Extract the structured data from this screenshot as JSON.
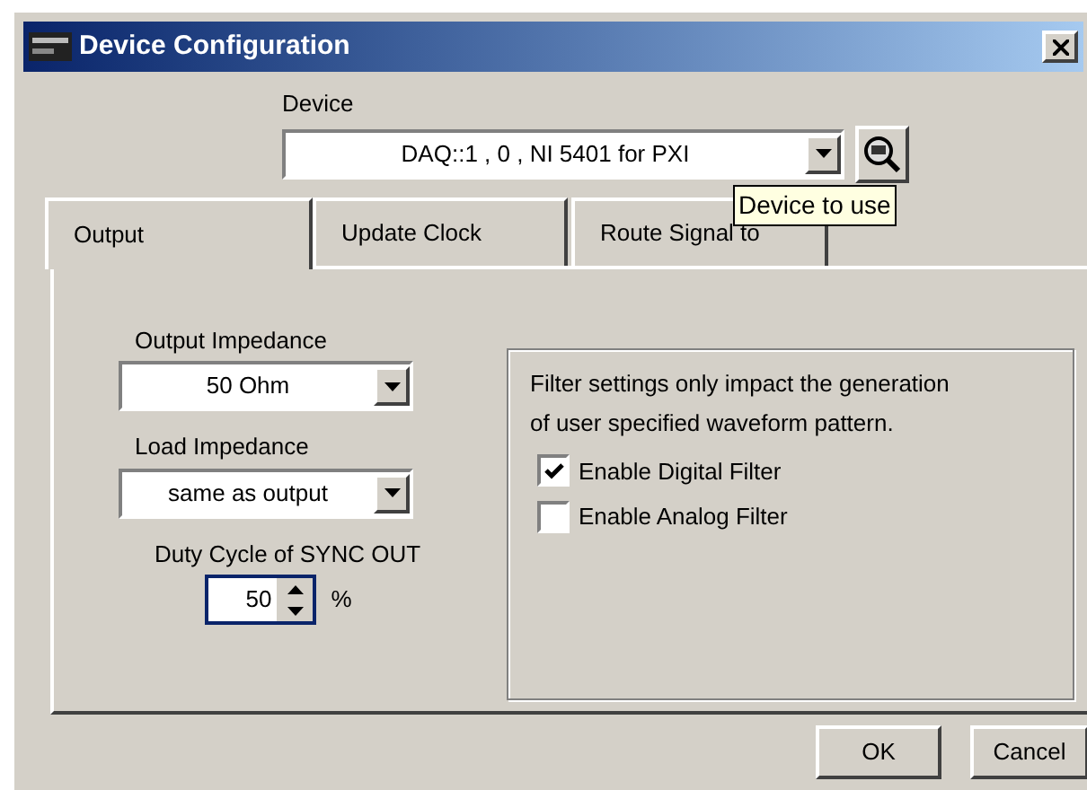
{
  "window": {
    "title": "Device Configuration"
  },
  "device": {
    "label": "Device",
    "value": "DAQ::1 , 0 , NI 5401 for PXI",
    "tooltip": "Device to use"
  },
  "tabs": [
    {
      "label": "Output",
      "selected": true
    },
    {
      "label": "Update Clock",
      "selected": false
    },
    {
      "label": "Route Signal to",
      "selected": false
    }
  ],
  "output_impedance": {
    "label": "Output Impedance",
    "value": "50 Ohm"
  },
  "load_impedance": {
    "label": "Load Impedance",
    "value": "same as output"
  },
  "duty_cycle": {
    "label": "Duty Cycle of SYNC OUT",
    "value": "50",
    "unit": "%"
  },
  "filter": {
    "note": "Filter settings only impact the generation of user specified waveform pattern.",
    "options": [
      {
        "label": "Enable Digital Filter",
        "checked": true
      },
      {
        "label": "Enable Analog Filter",
        "checked": false
      }
    ]
  },
  "buttons": [
    "OK",
    "Cancel"
  ]
}
